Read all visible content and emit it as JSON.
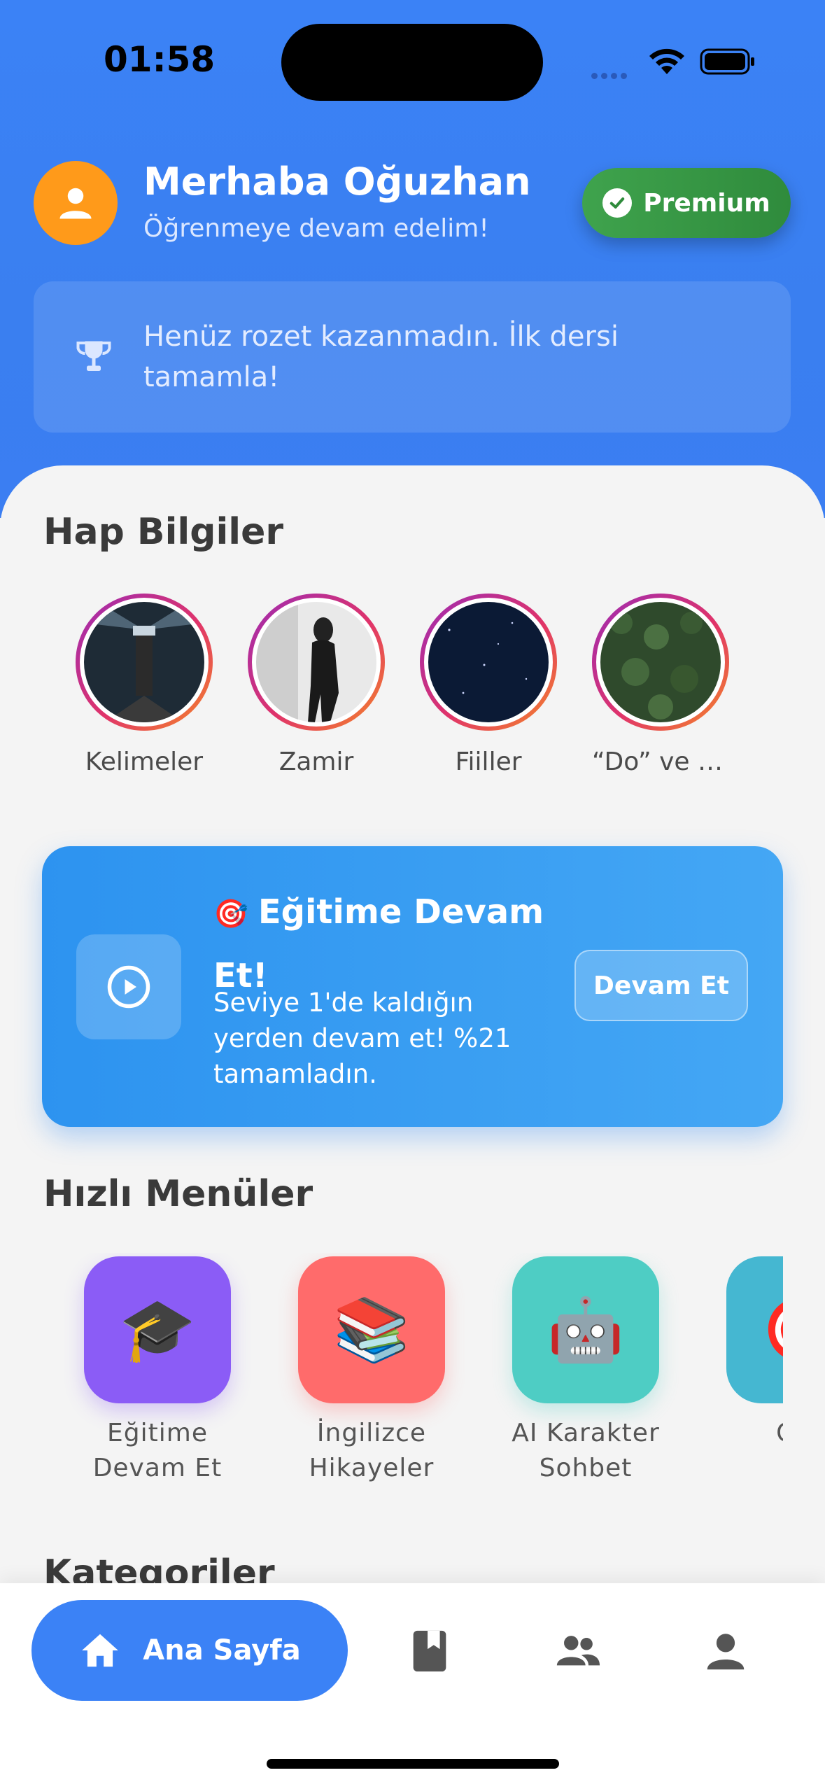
{
  "status_bar": {
    "time": "01:58"
  },
  "header": {
    "greeting": "Merhaba Oğuzhan",
    "subtitle": "Öğrenmeye devam edelim!",
    "premium_label": "Premium",
    "badge_message": "Henüz rozet kazanmadın. İlk dersi tamamla!"
  },
  "stories": {
    "title": "Hap Bilgiler",
    "items": [
      {
        "label": "Kelimeler"
      },
      {
        "label": "Zamir"
      },
      {
        "label": "Fiiller"
      },
      {
        "label": "“Do” ve “…"
      }
    ]
  },
  "continue_card": {
    "emoji": "🎯",
    "title": "Eğitime Devam Et!",
    "description": "Seviye 1'de kaldığın yerden devam et! %21 tamamladın.",
    "progress_percent": 21,
    "button_label": "Devam Et"
  },
  "quick_menus": {
    "title": "Hızlı Menüler",
    "items": [
      {
        "emoji": "🎓",
        "line1": "Eğitime",
        "line2": "Devam Et",
        "color": "#8b5cf6"
      },
      {
        "emoji": "📚",
        "line1": "İngilizce",
        "line2": "Hikayeler",
        "color": "#ff6b6b"
      },
      {
        "emoji": "🤖",
        "line1": "AI Karakter",
        "line2": "Sohbet",
        "color": "#4ecdc4"
      },
      {
        "emoji": "🎯",
        "line1": "Gör",
        "line2": "",
        "color": "#45b7d1"
      }
    ]
  },
  "categories": {
    "title": "Kategoriler"
  },
  "bottom_nav": {
    "home_label": "Ana Sayfa",
    "accent": "#3b82f6",
    "icons": [
      "home-icon",
      "book-icon",
      "people-icon",
      "profile-icon"
    ]
  }
}
